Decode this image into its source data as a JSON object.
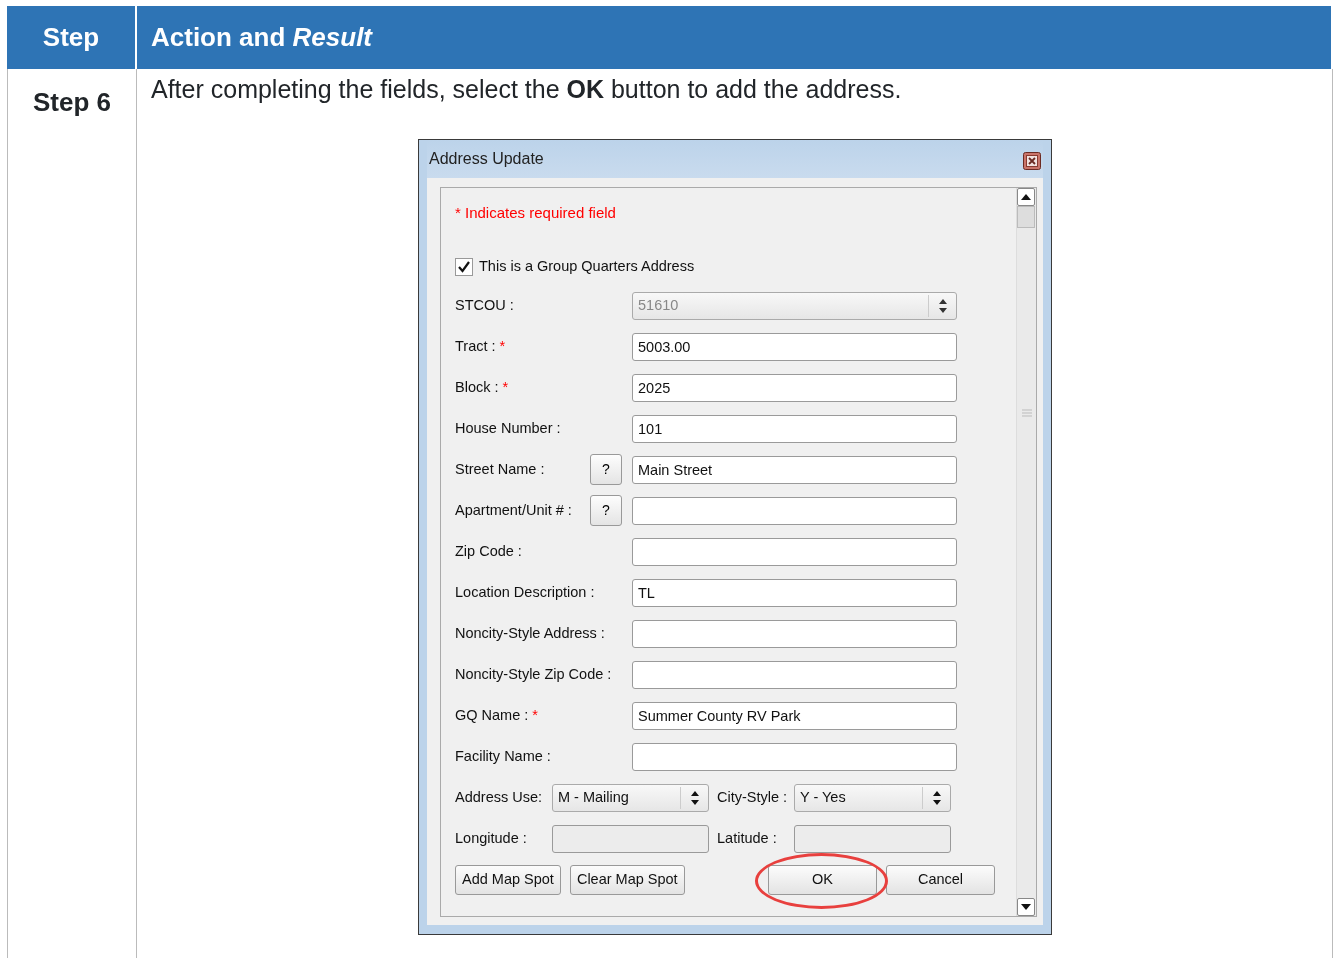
{
  "table": {
    "columns": [
      "Step",
      "Action and *Result*"
    ],
    "rows": [
      {
        "step": "Step 6",
        "instruction": "After completing the fields, select the **OK** button to add the address."
      }
    ]
  },
  "dialog": {
    "title": "Address Update",
    "required_note": "* Indicates required field",
    "group_quarters": {
      "label": "This is a Group Quarters Address",
      "checked": true
    },
    "fields": [
      {
        "label": "STCOU :",
        "kind": "combo",
        "value": "51610",
        "disabled": true
      },
      {
        "label": "Tract :",
        "required_mark": "*",
        "kind": "text",
        "value": "5003.00",
        "disabled": false
      },
      {
        "label": "Block :",
        "required_mark": "*",
        "kind": "text",
        "value": "2025",
        "disabled": false
      },
      {
        "label": "House Number :",
        "kind": "text",
        "value": "101",
        "disabled": false
      },
      {
        "label": "Street Name :",
        "kind": "text",
        "value": "Main Street",
        "disabled": false,
        "help": "?"
      },
      {
        "label": "Apartment/Unit # :",
        "kind": "text",
        "disabled": false,
        "help": "?"
      },
      {
        "label": "Zip Code :",
        "kind": "text",
        "disabled": false
      },
      {
        "label": "Location Description :",
        "kind": "text",
        "value": "TL",
        "disabled": false
      },
      {
        "label": "Noncity-Style Address :",
        "kind": "text",
        "disabled": false
      },
      {
        "label": "Noncity-Style Zip Code :",
        "kind": "text",
        "disabled": false
      },
      {
        "label": "GQ Name :",
        "required_mark": "*",
        "kind": "text",
        "value": "Summer County RV Park",
        "disabled": false
      },
      {
        "label": "Facility Name :",
        "kind": "text",
        "disabled": false
      }
    ],
    "paired_rows": [
      [
        {
          "label": "Address Use:",
          "kind": "combo",
          "value": "M - Mailing",
          "disabled": false
        },
        {
          "label": "City-Style :",
          "kind": "combo",
          "value": "Y - Yes",
          "disabled": false
        }
      ],
      [
        {
          "label": "Longitude :",
          "kind": "text",
          "disabled": true
        },
        {
          "label": "Latitude :",
          "kind": "text",
          "disabled": true
        }
      ]
    ],
    "left_buttons": [
      {
        "label": "Add Map Spot",
        "highlighted": false
      },
      {
        "label": "Clear Map Spot",
        "highlighted": false
      }
    ],
    "right_buttons": [
      {
        "label": "OK",
        "highlighted": true
      },
      {
        "label": "Cancel",
        "highlighted": false
      }
    ]
  }
}
